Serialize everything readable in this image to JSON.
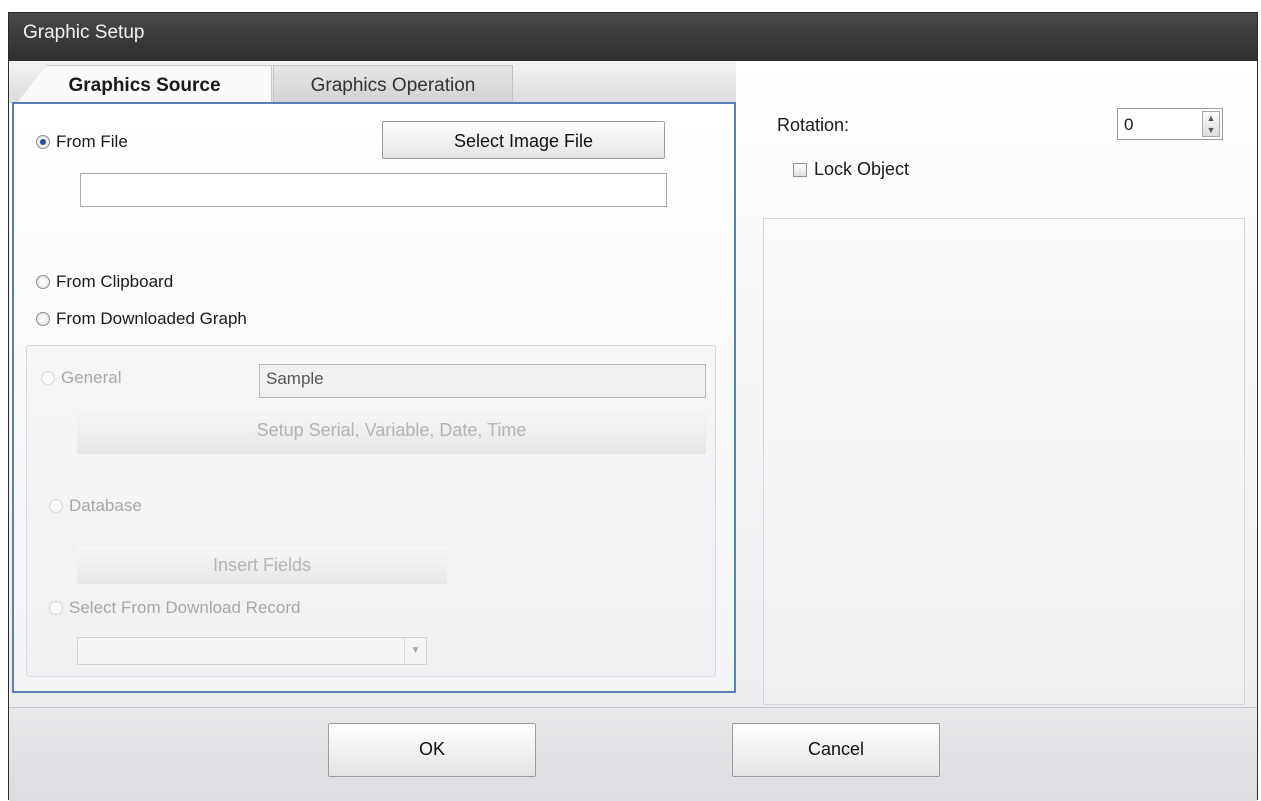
{
  "window": {
    "title": "Graphic Setup"
  },
  "tabs": [
    {
      "label": "Graphics Source",
      "active": true
    },
    {
      "label": "Graphics Operation",
      "active": false
    }
  ],
  "source": {
    "from_file": {
      "label": "From File",
      "selected": true
    },
    "select_image_button": "Select Image File",
    "file_path_value": "",
    "from_clipboard": {
      "label": "From Clipboard",
      "selected": false
    },
    "from_downloaded_graph": {
      "label": "From Downloaded Graph",
      "selected": false
    },
    "downloaded": {
      "general": {
        "label": "General",
        "enabled": false
      },
      "general_value": "Sample",
      "setup_button": "Setup Serial, Variable, Date, Time",
      "database": {
        "label": "Database",
        "enabled": false
      },
      "insert_fields_button": "Insert Fields",
      "select_record": {
        "label": "Select From Download Record",
        "enabled": false
      },
      "record_dropdown_value": ""
    }
  },
  "properties": {
    "rotation_label": "Rotation:",
    "rotation_value": "0",
    "lock_object_label": "Lock Object",
    "lock_object_checked": false
  },
  "footer": {
    "ok_label": "OK",
    "cancel_label": "Cancel"
  },
  "colors": {
    "titlebar": "#3a3a3a",
    "tab_panel_border": "#5b7fb5",
    "radio_selected": "#2a4d8a"
  }
}
